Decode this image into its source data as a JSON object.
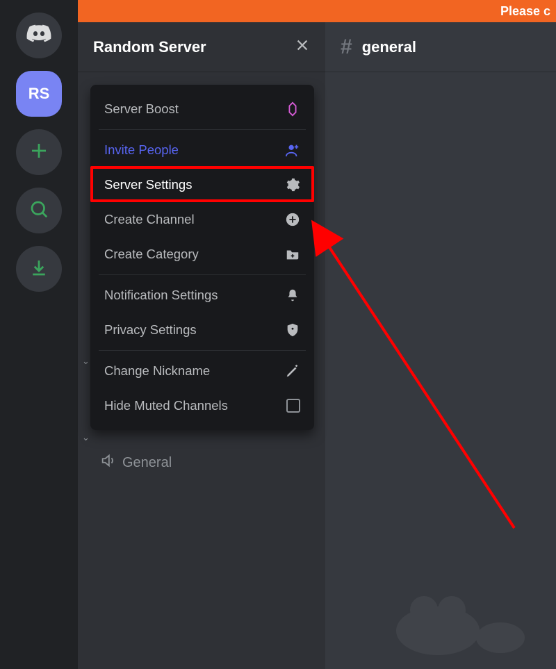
{
  "banner": {
    "text": "Please c"
  },
  "rail": {
    "selected_server_initials": "RS"
  },
  "sidebar": {
    "server_name": "Random Server",
    "voice_channel": "General"
  },
  "menu": {
    "boost": "Server Boost",
    "invite": "Invite People",
    "settings": "Server Settings",
    "create_channel": "Create Channel",
    "create_category": "Create Category",
    "notification": "Notification Settings",
    "privacy": "Privacy Settings",
    "nickname": "Change Nickname",
    "hide_muted": "Hide Muted Channels"
  },
  "chat": {
    "channel_name": "general"
  }
}
